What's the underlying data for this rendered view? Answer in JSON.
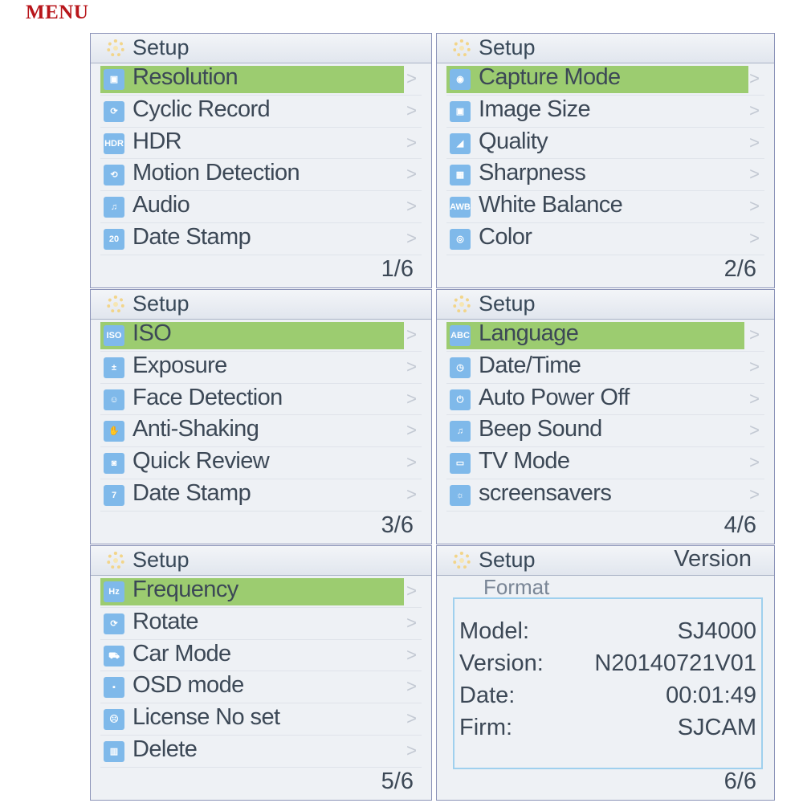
{
  "menu_title": "MENU",
  "screens": [
    {
      "header": "Setup",
      "page": "1/6",
      "items": [
        {
          "label": "Resolution",
          "icon": "resolution-icon",
          "glyph": "▣",
          "selected": true
        },
        {
          "label": "Cyclic Record",
          "icon": "cyclic-record-icon",
          "glyph": "⟳"
        },
        {
          "label": "HDR",
          "icon": "hdr-icon",
          "glyph": "HDR"
        },
        {
          "label": "Motion Detection",
          "icon": "motion-detection-icon",
          "glyph": "⟲"
        },
        {
          "label": "Audio",
          "icon": "music-note-icon",
          "glyph": "♫"
        },
        {
          "label": "Date Stamp",
          "icon": "calendar-icon",
          "glyph": "20"
        }
      ]
    },
    {
      "header": "Setup",
      "page": "2/6",
      "items": [
        {
          "label": "Capture Mode",
          "icon": "camera-icon",
          "glyph": "◉",
          "selected": true
        },
        {
          "label": "Image Size",
          "icon": "image-size-icon",
          "glyph": "▣"
        },
        {
          "label": "Quality",
          "icon": "quality-icon",
          "glyph": "◢"
        },
        {
          "label": "Sharpness",
          "icon": "sharpness-icon",
          "glyph": "▦"
        },
        {
          "label": "White Balance",
          "icon": "white-balance-icon",
          "glyph": "AWB"
        },
        {
          "label": "Color",
          "icon": "color-icon",
          "glyph": "◎"
        }
      ]
    },
    {
      "header": "Setup",
      "page": "3/6",
      "items": [
        {
          "label": "ISO",
          "icon": "iso-icon",
          "glyph": "ISO",
          "selected": true
        },
        {
          "label": "Exposure",
          "icon": "exposure-icon",
          "glyph": "±"
        },
        {
          "label": "Face Detection",
          "icon": "face-icon",
          "glyph": "☺"
        },
        {
          "label": "Anti-Shaking",
          "icon": "hand-icon",
          "glyph": "✋"
        },
        {
          "label": "Quick Review",
          "icon": "quick-review-icon",
          "glyph": "◙"
        },
        {
          "label": "Date Stamp",
          "icon": "calendar-icon",
          "glyph": "7"
        }
      ]
    },
    {
      "header": "Setup",
      "page": "4/6",
      "items": [
        {
          "label": "Language",
          "icon": "language-icon",
          "glyph": "ABC",
          "selected": true
        },
        {
          "label": "Date/Time",
          "icon": "clock-icon",
          "glyph": "◷"
        },
        {
          "label": "Auto Power Off",
          "icon": "power-icon",
          "glyph": "⏻"
        },
        {
          "label": "Beep Sound",
          "icon": "music-note-icon",
          "glyph": "♫"
        },
        {
          "label": "TV Mode",
          "icon": "tv-icon",
          "glyph": "▭"
        },
        {
          "label": "screensavers",
          "icon": "sun-icon",
          "glyph": "☼"
        }
      ]
    },
    {
      "header": "Setup",
      "page": "5/6",
      "items": [
        {
          "label": "Frequency",
          "icon": "frequency-icon",
          "glyph": "Hz",
          "selected": true
        },
        {
          "label": "Rotate",
          "icon": "rotate-icon",
          "glyph": "⟳"
        },
        {
          "label": "Car Mode",
          "icon": "car-icon",
          "glyph": "⛟"
        },
        {
          "label": "OSD mode",
          "icon": "osd-icon",
          "glyph": "▪"
        },
        {
          "label": "License No set",
          "icon": "license-icon",
          "glyph": "☹"
        },
        {
          "label": "Delete",
          "icon": "trash-icon",
          "glyph": "▥"
        }
      ]
    },
    {
      "header": "Setup",
      "page": "6/6",
      "version_title": "Version",
      "first_item": "Format",
      "version_info": {
        "model_label": "Model:",
        "model": "SJ4000",
        "version_label": "Version:",
        "version": "N20140721V01",
        "date_label": "Date:",
        "date": "00:01:49",
        "firm_label": "Firm:",
        "firm": "SJCAM"
      }
    }
  ],
  "colors": {
    "menu_title": "#b8161b",
    "highlight": "#9ccc70",
    "icon": "#7fb9ea",
    "text": "#3c4856"
  }
}
